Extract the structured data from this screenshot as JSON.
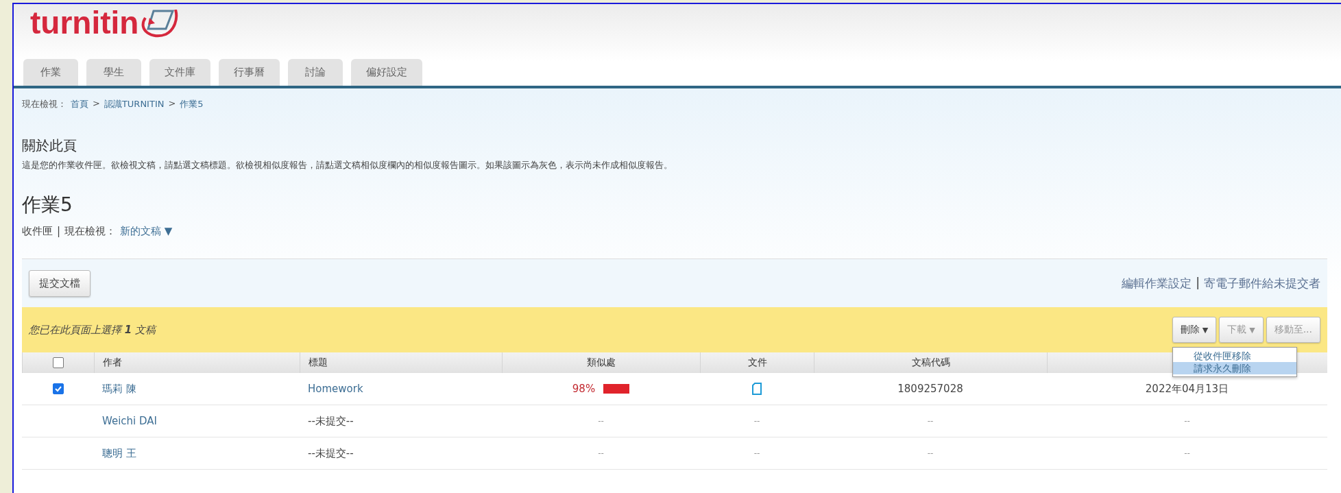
{
  "logo": {
    "text": "turnitin"
  },
  "tabs": [
    {
      "label": "作業"
    },
    {
      "label": "學生"
    },
    {
      "label": "文件庫"
    },
    {
      "label": "行事曆"
    },
    {
      "label": "討論"
    },
    {
      "label": "偏好設定"
    }
  ],
  "breadcrumb": {
    "label": "現在檢視：",
    "links": [
      "首頁",
      "認識TURNITIN",
      "作業5"
    ],
    "separator": ">"
  },
  "about": {
    "heading": "關於此頁",
    "text": "這是您的作業收件匣。欲檢視文稿，請點選文稿標題。欲檢視相似度報告，請點選文稿相似度欄內的相似度報告圖示。如果該圖示為灰色，表示尚未作成相似度報告。"
  },
  "assignment": {
    "title": "作業5",
    "inbox": "收件匣",
    "separator": "|",
    "viewing_label": "現在檢視：",
    "view": "新的文稿 ▼"
  },
  "toolbar": {
    "submit_button": "提交文檔",
    "links": [
      "編輯作業設定",
      "寄電子郵件給未提交者"
    ],
    "separator": "|"
  },
  "selection_bar": {
    "text": "您已在此頁面上選擇 **1** 文稿",
    "buttons": [
      {
        "label": "刪除",
        "caret": "▼",
        "disabled": false
      },
      {
        "label": "下載",
        "caret": "▼",
        "disabled": true
      },
      {
        "label": "移動至...",
        "disabled": true
      }
    ]
  },
  "delete_menu": {
    "items": [
      {
        "label": "從收件匣移除",
        "selected": false
      },
      {
        "label": "請求永久刪除",
        "selected": true
      }
    ]
  },
  "table": {
    "header_checkbox": {
      "checked": false
    },
    "columns": [
      "作者",
      "標題",
      "類似處",
      "文件",
      "文稿代碼"
    ],
    "rows": [
      {
        "checkbox": {
          "checked": true
        },
        "author": "瑪莉 陳",
        "title": "Homework",
        "title_link": true,
        "similarity": {
          "kind": "report",
          "text": "98%"
        },
        "file": {
          "kind": "icon"
        },
        "paper_id": "1809257028",
        "date": "2022年04月13日"
      },
      {
        "author": "Weichi DAI",
        "title": "--未提交--",
        "title_link": false,
        "similarity": {
          "kind": "text",
          "text": "--"
        },
        "file": {
          "kind": "text",
          "text": "--"
        },
        "paper_id": "--",
        "date": "--"
      },
      {
        "author": "聰明 王",
        "title": "--未提交--",
        "title_link": false,
        "similarity": {
          "kind": "text",
          "text": "--"
        },
        "file": {
          "kind": "text",
          "text": "--"
        },
        "paper_id": "--",
        "date": "--"
      }
    ]
  }
}
